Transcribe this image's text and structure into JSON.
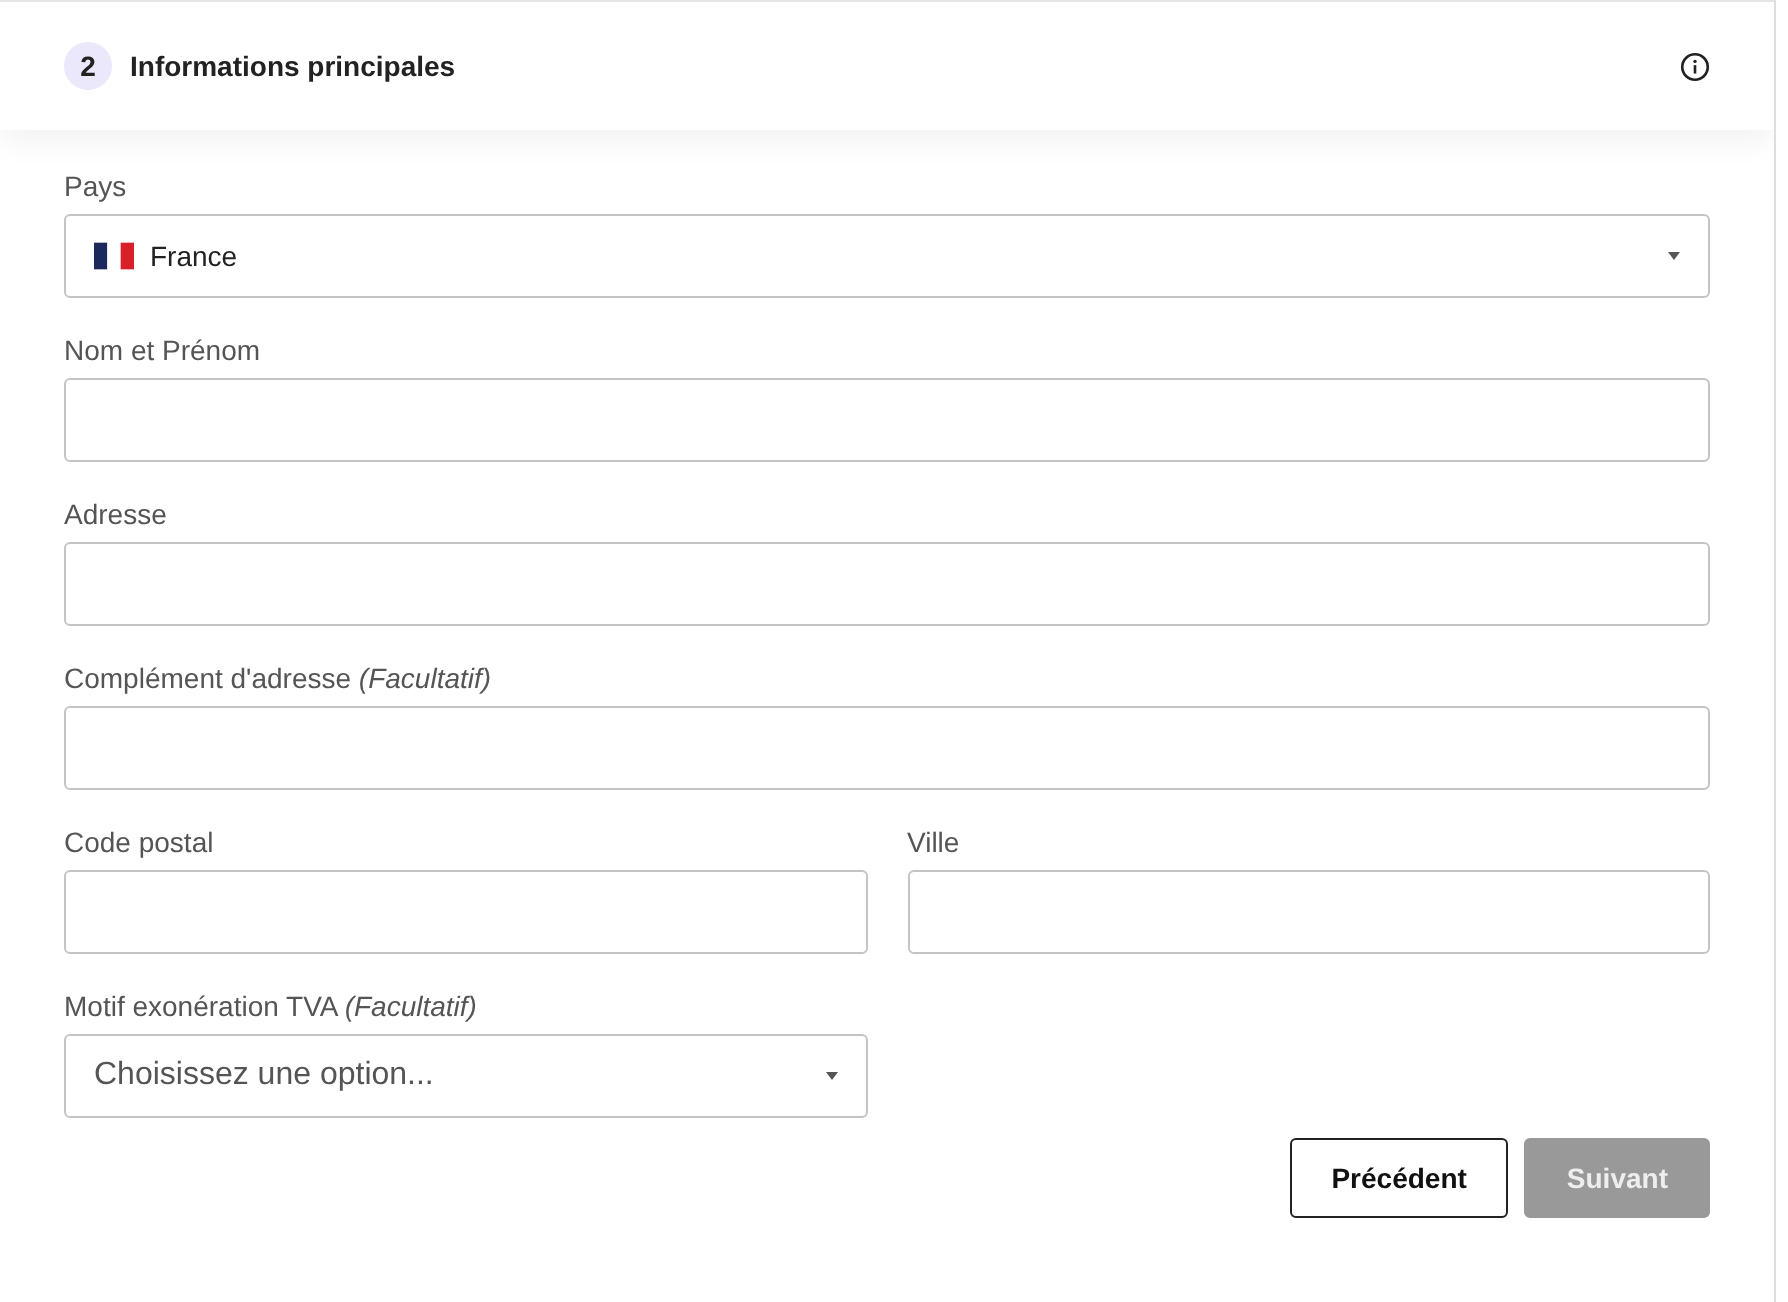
{
  "header": {
    "step": "2",
    "title": "Informations principales"
  },
  "rows": [
    {
      "fields": [
        {
          "kind": "country",
          "label": "Pays",
          "value": "France"
        }
      ]
    },
    {
      "fields": [
        {
          "kind": "text",
          "label": "Nom et Prénom"
        }
      ]
    },
    {
      "fields": [
        {
          "kind": "text",
          "label": "Adresse"
        }
      ]
    },
    {
      "fields": [
        {
          "kind": "text",
          "label": "Complément d'adresse",
          "optional": "(Facultatif)"
        }
      ]
    },
    {
      "fields": [
        {
          "kind": "text",
          "label": "Code postal"
        },
        {
          "kind": "text",
          "label": "Ville"
        }
      ]
    },
    {
      "fields": [
        {
          "kind": "select",
          "label": "Motif exonération TVA",
          "optional": "(Facultatif)",
          "placeholder": "Choisissez une option..."
        },
        {
          "kind": "empty"
        }
      ]
    }
  ],
  "buttons": [
    {
      "label": "Précédent",
      "disabled": false
    },
    {
      "label": "Suivant",
      "disabled": true
    }
  ]
}
